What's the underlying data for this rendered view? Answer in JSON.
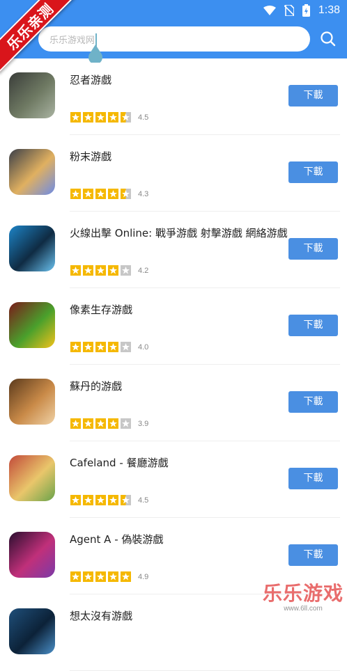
{
  "status": {
    "time": "1:38"
  },
  "brand": {
    "ribbon": "乐乐亲测",
    "watermark": "乐乐游戏",
    "watermark_url": "www.6ll.com"
  },
  "search": {
    "placeholder": "乐乐游戏网"
  },
  "apps": [
    {
      "title": "忍者游戲",
      "rating": "4.5",
      "stars": [
        1,
        1,
        1,
        1,
        0.5
      ],
      "download": "下載",
      "icon_colors": [
        "#3a3d3a",
        "#6f7a63",
        "#aab3a2"
      ]
    },
    {
      "title": "粉末游戲",
      "rating": "4.3",
      "stars": [
        1,
        1,
        1,
        1,
        0.5
      ],
      "download": "下載",
      "icon_colors": [
        "#3b3f48",
        "#e0b060",
        "#6d8be6"
      ]
    },
    {
      "title": "火線出擊 Online: 戰爭游戲 射擊游戲 網絡游戲",
      "rating": "4.2",
      "stars": [
        1,
        1,
        1,
        1,
        0
      ],
      "download": "下載",
      "icon_colors": [
        "#1d84c7",
        "#0f2b43",
        "#6ac2f0"
      ]
    },
    {
      "title": "像素生存游戲",
      "rating": "4.0",
      "stars": [
        1,
        1,
        1,
        1,
        0
      ],
      "download": "下載",
      "icon_colors": [
        "#7a1a1a",
        "#4aa02c",
        "#f2c21a"
      ]
    },
    {
      "title": "蘇丹的游戲",
      "rating": "3.9",
      "stars": [
        1,
        1,
        1,
        1,
        0
      ],
      "download": "下載",
      "icon_colors": [
        "#5b3a1c",
        "#c98a48",
        "#f0d2a6"
      ]
    },
    {
      "title": "Cafeland - 餐廳游戲",
      "rating": "4.5",
      "stars": [
        1,
        1,
        1,
        1,
        0.5
      ],
      "download": "下載",
      "icon_colors": [
        "#c24a3a",
        "#e9c66b",
        "#6aa34a"
      ]
    },
    {
      "title": "Agent A - 偽裝游戲",
      "rating": "4.9",
      "stars": [
        1,
        1,
        1,
        1,
        1
      ],
      "download": "下載",
      "icon_colors": [
        "#2a0f2f",
        "#c0307a",
        "#7b3aa8"
      ]
    },
    {
      "title": "想太沒有游戲",
      "rating": "",
      "stars": [],
      "download": "",
      "icon_colors": [
        "#1f4f7a",
        "#0c2238",
        "#4a8fc8"
      ]
    }
  ]
}
